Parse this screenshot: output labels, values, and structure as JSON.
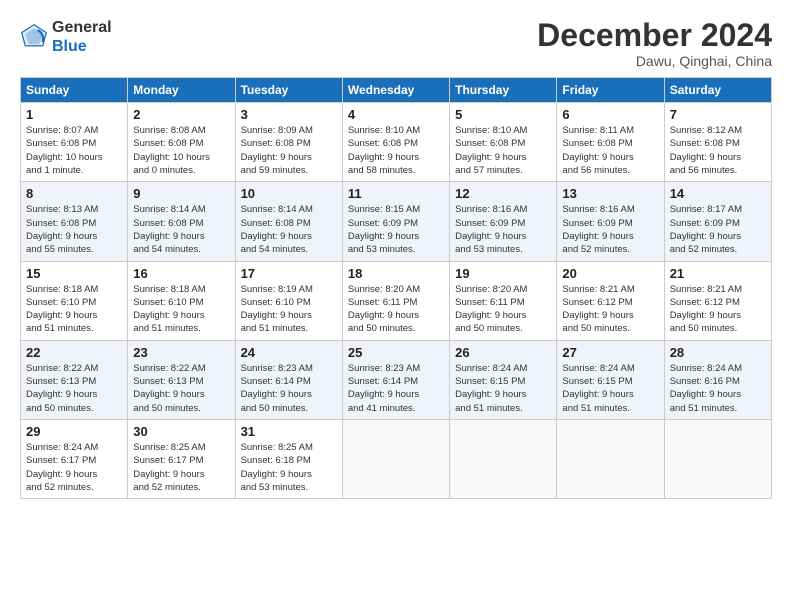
{
  "header": {
    "logo_line1": "General",
    "logo_line2": "Blue",
    "month": "December 2024",
    "location": "Dawu, Qinghai, China"
  },
  "weekdays": [
    "Sunday",
    "Monday",
    "Tuesday",
    "Wednesday",
    "Thursday",
    "Friday",
    "Saturday"
  ],
  "weeks": [
    [
      {
        "day": "1",
        "info": "Sunrise: 8:07 AM\nSunset: 6:08 PM\nDaylight: 10 hours\nand 1 minute."
      },
      {
        "day": "2",
        "info": "Sunrise: 8:08 AM\nSunset: 6:08 PM\nDaylight: 10 hours\nand 0 minutes."
      },
      {
        "day": "3",
        "info": "Sunrise: 8:09 AM\nSunset: 6:08 PM\nDaylight: 9 hours\nand 59 minutes."
      },
      {
        "day": "4",
        "info": "Sunrise: 8:10 AM\nSunset: 6:08 PM\nDaylight: 9 hours\nand 58 minutes."
      },
      {
        "day": "5",
        "info": "Sunrise: 8:10 AM\nSunset: 6:08 PM\nDaylight: 9 hours\nand 57 minutes."
      },
      {
        "day": "6",
        "info": "Sunrise: 8:11 AM\nSunset: 6:08 PM\nDaylight: 9 hours\nand 56 minutes."
      },
      {
        "day": "7",
        "info": "Sunrise: 8:12 AM\nSunset: 6:08 PM\nDaylight: 9 hours\nand 56 minutes."
      }
    ],
    [
      {
        "day": "8",
        "info": "Sunrise: 8:13 AM\nSunset: 6:08 PM\nDaylight: 9 hours\nand 55 minutes."
      },
      {
        "day": "9",
        "info": "Sunrise: 8:14 AM\nSunset: 6:08 PM\nDaylight: 9 hours\nand 54 minutes."
      },
      {
        "day": "10",
        "info": "Sunrise: 8:14 AM\nSunset: 6:08 PM\nDaylight: 9 hours\nand 54 minutes."
      },
      {
        "day": "11",
        "info": "Sunrise: 8:15 AM\nSunset: 6:09 PM\nDaylight: 9 hours\nand 53 minutes."
      },
      {
        "day": "12",
        "info": "Sunrise: 8:16 AM\nSunset: 6:09 PM\nDaylight: 9 hours\nand 53 minutes."
      },
      {
        "day": "13",
        "info": "Sunrise: 8:16 AM\nSunset: 6:09 PM\nDaylight: 9 hours\nand 52 minutes."
      },
      {
        "day": "14",
        "info": "Sunrise: 8:17 AM\nSunset: 6:09 PM\nDaylight: 9 hours\nand 52 minutes."
      }
    ],
    [
      {
        "day": "15",
        "info": "Sunrise: 8:18 AM\nSunset: 6:10 PM\nDaylight: 9 hours\nand 51 minutes."
      },
      {
        "day": "16",
        "info": "Sunrise: 8:18 AM\nSunset: 6:10 PM\nDaylight: 9 hours\nand 51 minutes."
      },
      {
        "day": "17",
        "info": "Sunrise: 8:19 AM\nSunset: 6:10 PM\nDaylight: 9 hours\nand 51 minutes."
      },
      {
        "day": "18",
        "info": "Sunrise: 8:20 AM\nSunset: 6:11 PM\nDaylight: 9 hours\nand 50 minutes."
      },
      {
        "day": "19",
        "info": "Sunrise: 8:20 AM\nSunset: 6:11 PM\nDaylight: 9 hours\nand 50 minutes."
      },
      {
        "day": "20",
        "info": "Sunrise: 8:21 AM\nSunset: 6:12 PM\nDaylight: 9 hours\nand 50 minutes."
      },
      {
        "day": "21",
        "info": "Sunrise: 8:21 AM\nSunset: 6:12 PM\nDaylight: 9 hours\nand 50 minutes."
      }
    ],
    [
      {
        "day": "22",
        "info": "Sunrise: 8:22 AM\nSunset: 6:13 PM\nDaylight: 9 hours\nand 50 minutes."
      },
      {
        "day": "23",
        "info": "Sunrise: 8:22 AM\nSunset: 6:13 PM\nDaylight: 9 hours\nand 50 minutes."
      },
      {
        "day": "24",
        "info": "Sunrise: 8:23 AM\nSunset: 6:14 PM\nDaylight: 9 hours\nand 50 minutes."
      },
      {
        "day": "25",
        "info": "Sunrise: 8:23 AM\nSunset: 6:14 PM\nDaylight: 9 hours\nand 41 minutes."
      },
      {
        "day": "26",
        "info": "Sunrise: 8:24 AM\nSunset: 6:15 PM\nDaylight: 9 hours\nand 51 minutes."
      },
      {
        "day": "27",
        "info": "Sunrise: 8:24 AM\nSunset: 6:15 PM\nDaylight: 9 hours\nand 51 minutes."
      },
      {
        "day": "28",
        "info": "Sunrise: 8:24 AM\nSunset: 6:16 PM\nDaylight: 9 hours\nand 51 minutes."
      }
    ],
    [
      {
        "day": "29",
        "info": "Sunrise: 8:24 AM\nSunset: 6:17 PM\nDaylight: 9 hours\nand 52 minutes."
      },
      {
        "day": "30",
        "info": "Sunrise: 8:25 AM\nSunset: 6:17 PM\nDaylight: 9 hours\nand 52 minutes."
      },
      {
        "day": "31",
        "info": "Sunrise: 8:25 AM\nSunset: 6:18 PM\nDaylight: 9 hours\nand 53 minutes."
      },
      {
        "day": "",
        "info": ""
      },
      {
        "day": "",
        "info": ""
      },
      {
        "day": "",
        "info": ""
      },
      {
        "day": "",
        "info": ""
      }
    ]
  ]
}
